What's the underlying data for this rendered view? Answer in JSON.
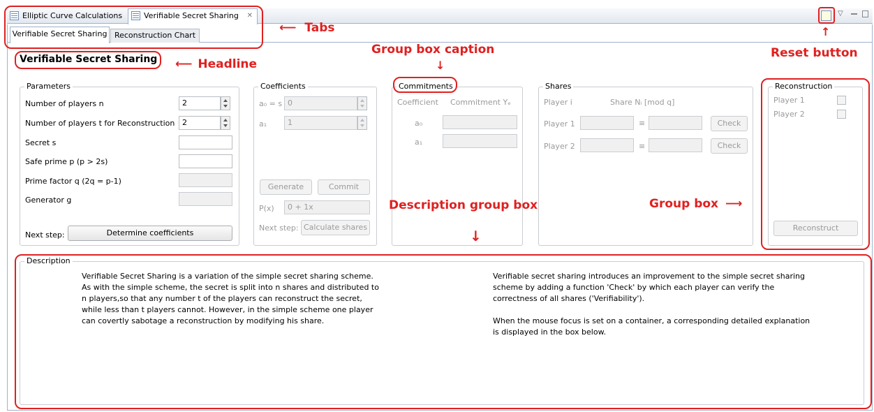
{
  "editor_tabs": [
    {
      "label": "Elliptic Curve Calculations",
      "close": ""
    },
    {
      "label": "Verifiable Secret Sharing",
      "close": "✕"
    }
  ],
  "sub_tabs": [
    "Verifiable Secret Sharing",
    "Reconstruction Chart"
  ],
  "headline": "Verifiable Secret Sharing",
  "parameters": {
    "caption": "Parameters",
    "n_label": "Number of players n",
    "n_value": "2",
    "t_label": "Number of players t for Reconstruction",
    "t_value": "2",
    "secret_label": "Secret s",
    "prime_label": "Safe prime p (p > 2s)",
    "q_label": "Prime factor q (2q = p-1)",
    "g_label": "Generator g",
    "next_label": "Next step:",
    "next_button": "Determine coefficients"
  },
  "coefficients": {
    "caption": "Coefficients",
    "a0_label": "a₀ = s",
    "a0_value": "0",
    "a1_label": "a₁",
    "a1_value": "1",
    "generate": "Generate",
    "commit": "Commit",
    "px_label": "P(x)",
    "px_value": "0 + 1x",
    "next_label": "Next step:",
    "next_button": "Calculate shares"
  },
  "commitments": {
    "caption": "Commitments",
    "col_coefficient": "Coefficient",
    "col_commitment": "Commitment Yₑ",
    "rows": [
      "a₀",
      "a₁"
    ]
  },
  "shares": {
    "caption": "Shares",
    "col_player": "Player i",
    "col_share": "Share Nᵢ [mod q]",
    "eq": "≡",
    "check": "Check",
    "rows": [
      "Player 1",
      "Player 2"
    ]
  },
  "reconstruction": {
    "caption": "Reconstruction",
    "players": [
      "Player 1",
      "Player 2"
    ],
    "button": "Reconstruct"
  },
  "description": {
    "caption": "Description",
    "left": "Verifiable Secret Sharing is a variation of the simple secret sharing scheme. As with the simple scheme, the secret is split into n shares and distributed to n players,so that any number t of the players can reconstruct the secret, while less than t players cannot. However, in the simple scheme one player can covertly sabotage a reconstruction by modifying his share.",
    "right1": "Verifiable secret sharing introduces an improvement to the simple secret sharing scheme by adding a function 'Check' by which each player can verify the correctness of all shares ('Verifiability').",
    "right2": "When the mouse focus is set on a container, a corresponding detailed explanation is displayed in the box below."
  },
  "annotations": {
    "tabs": "Tabs",
    "headline": "Headline",
    "group_box_caption": "Group box caption",
    "reset_button": "Reset button",
    "description_group_box": "Description group box",
    "group_box": "Group box"
  },
  "colors": {
    "annotation": "#e02020",
    "border": "#c9cdd2"
  }
}
